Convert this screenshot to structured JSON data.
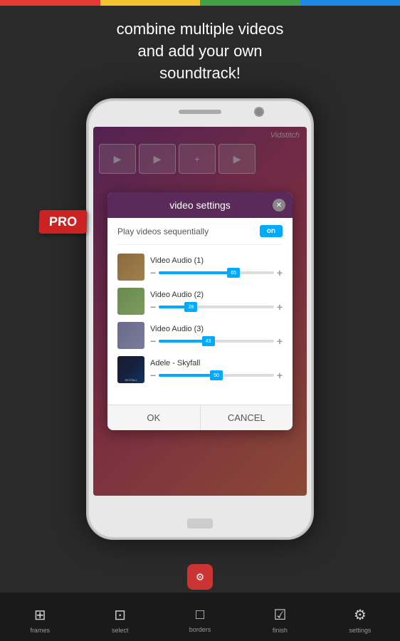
{
  "top_bar": {
    "colors": [
      "#e53935",
      "#f4c430",
      "#43a047",
      "#1e88e5"
    ]
  },
  "header": {
    "line1": "combine multiple videos",
    "line2": "and add your own",
    "line3": "soundtrack!"
  },
  "pro_badge": "PRO",
  "phone": {
    "app_name": "Vidstitch",
    "dialog": {
      "title": "video settings",
      "sequential_label": "Play videos sequentially",
      "toggle_state": "on",
      "audio_items": [
        {
          "id": 1,
          "title": "Video Audio (1)",
          "value": 65,
          "percent": 65
        },
        {
          "id": 2,
          "title": "Video Audio (2)",
          "value": 28,
          "percent": 28
        },
        {
          "id": 3,
          "title": "Video Audio (3)",
          "value": 43,
          "percent": 43
        },
        {
          "id": 4,
          "title": "Adele - Skyfall",
          "value": 50,
          "percent": 50
        }
      ],
      "ok_button": "OK",
      "cancel_button": "CANCEL"
    }
  },
  "bottom_nav": {
    "items": [
      {
        "label": "frames",
        "icon": "⊞"
      },
      {
        "label": "select",
        "icon": "⊡"
      },
      {
        "label": "borders",
        "icon": "□"
      },
      {
        "label": "finish",
        "icon": "☑"
      },
      {
        "label": "settings",
        "icon": "⚙"
      }
    ]
  }
}
